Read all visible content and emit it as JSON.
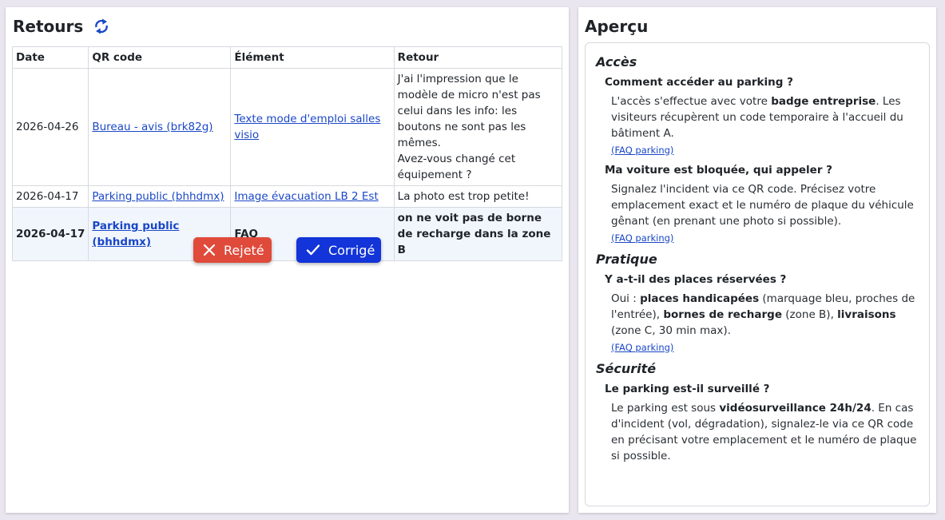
{
  "retours": {
    "title": "Retours",
    "refresh_icon": "refresh-icon",
    "headers": {
      "date": "Date",
      "qr": "QR code",
      "element": "Élément",
      "retour": "Retour"
    },
    "rows": [
      {
        "date": "2026-04-26",
        "qr": "Bureau - avis (brk82g)",
        "element": "Texte mode d'emploi salles visio",
        "retour_lines": [
          "J'ai l'impression que le modèle de micro n'est pas celui dans les info: les boutons ne sont pas les mêmes.",
          "Avez-vous changé cet équipement ?"
        ]
      },
      {
        "date": "2026-04-17",
        "qr": "Parking public (bhhdmx)",
        "element": "Image évacuation LB 2 Est",
        "retour_lines": [
          "La photo est trop petite!"
        ]
      },
      {
        "date": "2026-04-17",
        "qr": "Parking public (bhhdmx)",
        "element": "FAQ",
        "retour_lines": [
          "on ne voit pas de borne de recharge dans la zone B"
        ]
      }
    ],
    "buttons": {
      "reject": "Rejeté",
      "fixed": "Corrigé"
    },
    "colors": {
      "reject": "#e04a3b",
      "fixed": "#1234d8",
      "link": "#1a47c7"
    }
  },
  "apercu": {
    "title": "Aperçu",
    "faq_link": "(FAQ parking)",
    "sections": {
      "acces": {
        "title": "Accès",
        "q1": "Comment accéder au parking ?",
        "a1": {
          "t1": "L'accès s'effectue avec votre ",
          "b1": "badge entreprise",
          "t2": ". Les visiteurs récupèrent un code temporaire à l'accueil du bâtiment A."
        },
        "q2": "Ma voiture est bloquée, qui appeler ?",
        "a2": "Signalez l'incident via ce QR code. Précisez votre emplacement exact et le numéro de plaque du véhicule gênant (en prenant une photo si possible)."
      },
      "pratique": {
        "title": "Pratique",
        "q1": "Y a-t-il des places réservées ?",
        "a1": {
          "t1": "Oui : ",
          "b1": "places handicapées",
          "t2": " (marquage bleu, proches de l'entrée), ",
          "b2": "bornes de recharge",
          "t3": " (zone B), ",
          "b3": "livraisons",
          "t4": " (zone C, 30 min max)."
        }
      },
      "securite": {
        "title": "Sécurité",
        "q1": "Le parking est-il surveillé ?",
        "a1": {
          "t1": "Le parking est sous ",
          "b1": "vidéosurveillance 24h/24",
          "t2": ". En cas d'incident (vol, dégradation), signalez-le via ce QR code en précisant votre emplacement et le numéro de plaque si possible."
        }
      }
    }
  }
}
